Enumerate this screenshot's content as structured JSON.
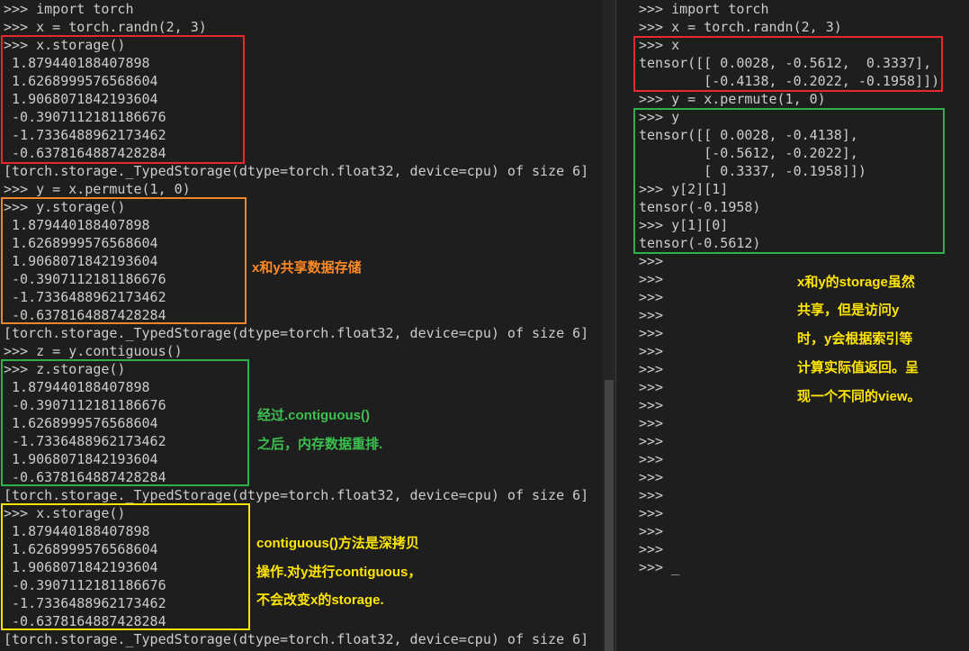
{
  "left_terminal": {
    "lines": [
      ">>> import torch",
      ">>> x = torch.randn(2, 3)",
      ">>> x.storage()",
      " 1.879440188407898",
      " 1.6268999576568604",
      " 1.9068071842193604",
      " -0.3907112181186676",
      " -1.7336488962173462",
      " -0.6378164887428284",
      "[torch.storage._TypedStorage(dtype=torch.float32, device=cpu) of size 6]",
      ">>> y = x.permute(1, 0)",
      ">>> y.storage()",
      " 1.879440188407898",
      " 1.6268999576568604",
      " 1.9068071842193604",
      " -0.3907112181186676",
      " -1.7336488962173462",
      " -0.6378164887428284",
      "[torch.storage._TypedStorage(dtype=torch.float32, device=cpu) of size 6]",
      ">>> z = y.contiguous()",
      ">>> z.storage()",
      " 1.879440188407898",
      " -0.3907112181186676",
      " 1.6268999576568604",
      " -1.7336488962173462",
      " 1.9068071842193604",
      " -0.6378164887428284",
      "[torch.storage._TypedStorage(dtype=torch.float32, device=cpu) of size 6]",
      ">>> x.storage()",
      " 1.879440188407898",
      " 1.6268999576568604",
      " 1.9068071842193604",
      " -0.3907112181186676",
      " -1.7336488962173462",
      " -0.6378164887428284",
      "[torch.storage._TypedStorage(dtype=torch.float32, device=cpu) of size 6]"
    ]
  },
  "right_terminal": {
    "lines": [
      ">>> import torch",
      ">>> x = torch.randn(2, 3)",
      ">>> x",
      "tensor([[ 0.0028, -0.5612,  0.3337],",
      "        [-0.4138, -0.2022, -0.1958]])",
      ">>> y = x.permute(1, 0)",
      ">>> y",
      "tensor([[ 0.0028, -0.4138],",
      "        [-0.5612, -0.2022],",
      "        [ 0.3337, -0.1958]])",
      ">>> y[2][1]",
      "tensor(-0.1958)",
      ">>> y[1][0]",
      "tensor(-0.5612)",
      ">>>",
      ">>>",
      ">>>",
      ">>>",
      ">>>",
      ">>>",
      ">>>",
      ">>>",
      ">>>",
      ">>>",
      ">>>",
      ">>>",
      ">>>",
      ">>>",
      ">>>",
      ">>>",
      ">>>",
      ">>> _"
    ]
  },
  "annotations": {
    "shared_storage": "x和y共享数据存储",
    "contiguous_1": "经过.contiguous()",
    "contiguous_2": "之后，内存数据重排.",
    "deepcopy_1": "contiguous()方法是深拷贝",
    "deepcopy_2": "操作.对y进行contiguous，",
    "deepcopy_3": "不会改变x的storage.",
    "view_1": "x和y的storage虽然",
    "view_2": "共享，但是访问y",
    "view_3": "时，y会根据索引等",
    "view_4": "计算实际值返回。呈",
    "view_5": "现一个不同的view。"
  },
  "colors": {
    "background": "#1e1e1e",
    "terminal_text": "#cccccc",
    "highlight_red": "#e8282c",
    "highlight_orange": "#f0862a",
    "highlight_green": "#2db24a",
    "highlight_yellow": "#f5e400",
    "note_orange": "#ff8a25",
    "note_green": "#3cc050",
    "note_yellow": "#ffe600"
  },
  "icons": {
    "scrollbar": "vertical-scrollbar"
  }
}
